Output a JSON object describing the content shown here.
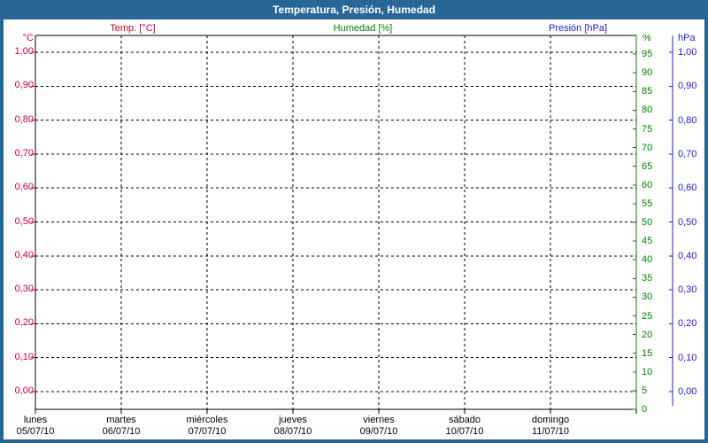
{
  "title": "Temperatura, Presión, Humedad",
  "legend": {
    "temp": {
      "label": "Temp. [°C]",
      "color": "#cc0033"
    },
    "humidity": {
      "label": "Humedad [%]",
      "color": "#008000"
    },
    "pressure": {
      "label": "Presión [hPa]",
      "color": "#2222cc"
    }
  },
  "colors": {
    "frame_blue": "#2b6da0",
    "red": "#cc0033",
    "green": "#008000",
    "blue": "#2222cc",
    "grid": "#000000"
  },
  "chart_data": {
    "type": "line",
    "title": "Temperatura, Presión, Humedad",
    "note": "empty plot grid — no data series points are drawn in the screenshot",
    "grid": "dashed black, 7 day columns, horizontal line each 0,10 of left scale",
    "legend_position": "top, three colored labels",
    "series": [
      {
        "name": "Temp. [°C]",
        "axis": "left_temperature",
        "color": "#cc0033",
        "values": []
      },
      {
        "name": "Humedad [%]",
        "axis": "right_humidity",
        "color": "#008000",
        "values": []
      },
      {
        "name": "Presión [hPa]",
        "axis": "right_pressure",
        "color": "#2222cc",
        "values": []
      }
    ],
    "left_axis": {
      "unit": "°C",
      "range": [
        0,
        1
      ],
      "ticks": [
        "1,00",
        "0,90",
        "0,80",
        "0,70",
        "0,60",
        "0,50",
        "0,40",
        "0,30",
        "0,20",
        "0,10",
        "0,00"
      ]
    },
    "humidity_axis": {
      "unit": "%",
      "range": [
        0,
        100
      ],
      "ticks": [
        95,
        90,
        85,
        80,
        75,
        70,
        65,
        60,
        55,
        50,
        45,
        40,
        35,
        30,
        25,
        20,
        15,
        10,
        5,
        0
      ]
    },
    "pressure_axis": {
      "unit": "hPa",
      "range": [
        0,
        1
      ],
      "ticks": [
        "1,00",
        "0,90",
        "0,80",
        "0,70",
        "0,60",
        "0,50",
        "0,40",
        "0,30",
        "0,20",
        "0,10",
        "0,00"
      ]
    },
    "x_axis": {
      "days": [
        {
          "name": "lunes",
          "date": "05/07/10"
        },
        {
          "name": "martes",
          "date": "06/07/10"
        },
        {
          "name": "miércoles",
          "date": "07/07/10"
        },
        {
          "name": "jueves",
          "date": "08/07/10"
        },
        {
          "name": "viernes",
          "date": "09/07/10"
        },
        {
          "name": "sábado",
          "date": "10/07/10"
        },
        {
          "name": "domingo",
          "date": "11/07/10"
        }
      ]
    }
  }
}
